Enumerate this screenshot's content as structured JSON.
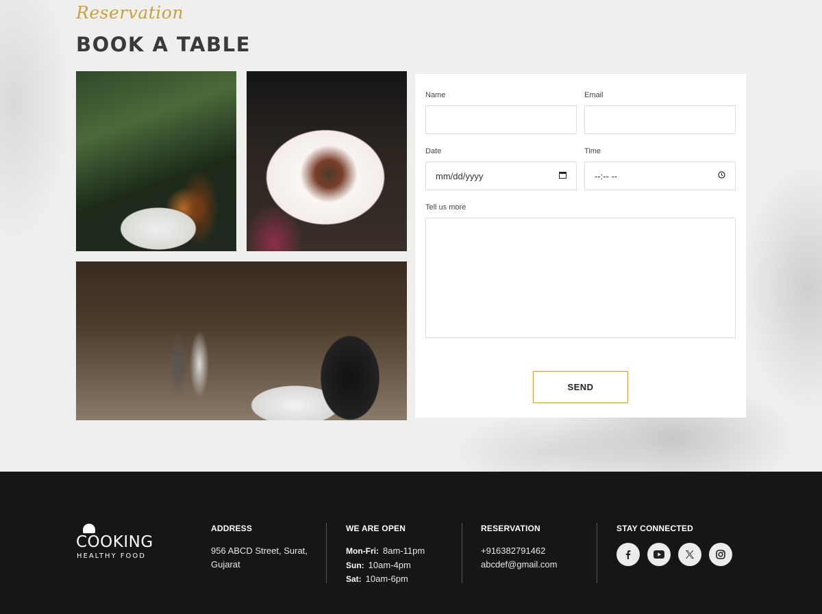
{
  "header": {
    "script_title": "Reservation",
    "title": "BOOK A TABLE"
  },
  "form": {
    "name_label": "Name",
    "email_label": "Email",
    "date_label": "Date",
    "date_placeholder": "mm/dd/yyyy",
    "time_label": "Time",
    "time_placeholder": "--:-- --",
    "message_label": "Tell us more",
    "send_label": "SEND"
  },
  "footer": {
    "logo_word": "COOKING",
    "logo_sub": "HEALTHY FOOD",
    "address": {
      "heading": "ADDRESS",
      "line1": "956 ABCD Street, Surat,",
      "line2": "Gujarat"
    },
    "hours": {
      "heading": "WE ARE OPEN",
      "rows": [
        {
          "day": "Mon-Fri:",
          "time": "8am-11pm"
        },
        {
          "day": "Sun:",
          "time": "10am-4pm"
        },
        {
          "day": "Sat:",
          "time": "10am-6pm"
        }
      ]
    },
    "reservation": {
      "heading": "RESERVATION",
      "phone": "+916382791462",
      "email": "abcdef@gmail.com"
    },
    "social": {
      "heading": "STAY CONNECTED",
      "icons": [
        "facebook-icon",
        "youtube-icon",
        "x-icon",
        "instagram-icon"
      ]
    }
  },
  "colors": {
    "accent": "#c9a040",
    "footer_bg": "#161616",
    "page_bg": "#efefee"
  }
}
